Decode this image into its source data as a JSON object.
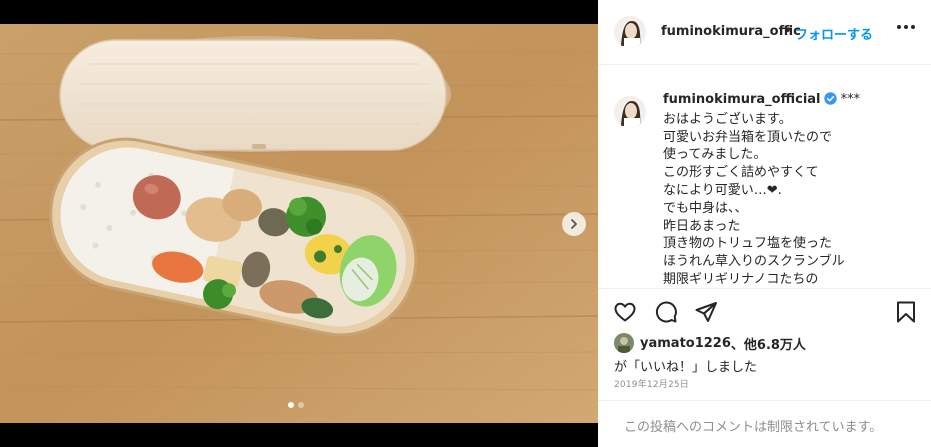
{
  "author": {
    "username": "fuminokimura_official",
    "header_username": "fuminokimura_offic",
    "follow_label": "フォローする",
    "verified": true
  },
  "caption": {
    "lines": [
      "おはようございます。",
      "可愛いお弁当箱を頂いたので",
      "使ってみました。",
      "この形すごく詰めやすくて",
      "なにより可愛い…❤︎.",
      "でも中身は、、",
      "昨日あまった",
      "頂き物のトリュフ塩を使った",
      "ほうれん草入りのスクランブル",
      "期限ギリギリナノコたちの"
    ],
    "stars": "***"
  },
  "likes": {
    "liker": "yamato1226",
    "others_label": "、他6.8万人",
    "suffix": "が「いいね！」しました"
  },
  "post_date": "2019年12月25日",
  "comments_disabled": "この投稿へのコメントは制限されています。",
  "carousel": {
    "total": 2,
    "current": 1
  },
  "colors": {
    "accent": "#0095f6",
    "verified": "#3897f0",
    "wood": "#c89a62"
  }
}
